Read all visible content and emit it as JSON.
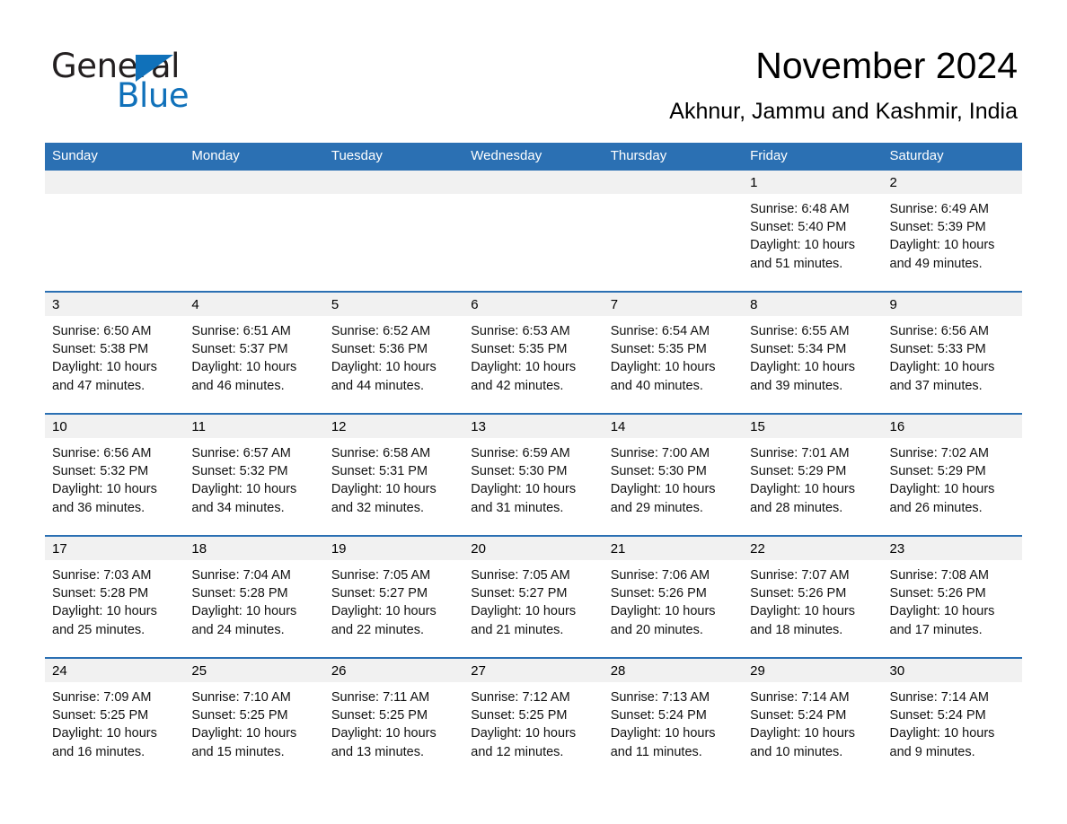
{
  "logo": {
    "word_one": "General",
    "word_two": "Blue",
    "triangle_icon": "triangle-icon",
    "brand_color": "#1071BA"
  },
  "header": {
    "month_title": "November 2024",
    "location": "Akhnur, Jammu and Kashmir, India"
  },
  "theme": {
    "header_blue": "#2B70B3",
    "daynum_band": "#F1F1F1",
    "cell_bg": "#FFFFFF"
  },
  "weekday_headers": [
    "Sunday",
    "Monday",
    "Tuesday",
    "Wednesday",
    "Thursday",
    "Friday",
    "Saturday"
  ],
  "weeks": [
    [
      {
        "day": "",
        "blank": true,
        "sunrise": "",
        "sunset": "",
        "daylight_line1": "",
        "daylight_line2": ""
      },
      {
        "day": "",
        "blank": true,
        "sunrise": "",
        "sunset": "",
        "daylight_line1": "",
        "daylight_line2": ""
      },
      {
        "day": "",
        "blank": true,
        "sunrise": "",
        "sunset": "",
        "daylight_line1": "",
        "daylight_line2": ""
      },
      {
        "day": "",
        "blank": true,
        "sunrise": "",
        "sunset": "",
        "daylight_line1": "",
        "daylight_line2": ""
      },
      {
        "day": "",
        "blank": true,
        "sunrise": "",
        "sunset": "",
        "daylight_line1": "",
        "daylight_line2": ""
      },
      {
        "day": "1",
        "blank": false,
        "sunrise": "Sunrise: 6:48 AM",
        "sunset": "Sunset: 5:40 PM",
        "daylight_line1": "Daylight: 10 hours",
        "daylight_line2": "and 51 minutes."
      },
      {
        "day": "2",
        "blank": false,
        "sunrise": "Sunrise: 6:49 AM",
        "sunset": "Sunset: 5:39 PM",
        "daylight_line1": "Daylight: 10 hours",
        "daylight_line2": "and 49 minutes."
      }
    ],
    [
      {
        "day": "3",
        "blank": false,
        "sunrise": "Sunrise: 6:50 AM",
        "sunset": "Sunset: 5:38 PM",
        "daylight_line1": "Daylight: 10 hours",
        "daylight_line2": "and 47 minutes."
      },
      {
        "day": "4",
        "blank": false,
        "sunrise": "Sunrise: 6:51 AM",
        "sunset": "Sunset: 5:37 PM",
        "daylight_line1": "Daylight: 10 hours",
        "daylight_line2": "and 46 minutes."
      },
      {
        "day": "5",
        "blank": false,
        "sunrise": "Sunrise: 6:52 AM",
        "sunset": "Sunset: 5:36 PM",
        "daylight_line1": "Daylight: 10 hours",
        "daylight_line2": "and 44 minutes."
      },
      {
        "day": "6",
        "blank": false,
        "sunrise": "Sunrise: 6:53 AM",
        "sunset": "Sunset: 5:35 PM",
        "daylight_line1": "Daylight: 10 hours",
        "daylight_line2": "and 42 minutes."
      },
      {
        "day": "7",
        "blank": false,
        "sunrise": "Sunrise: 6:54 AM",
        "sunset": "Sunset: 5:35 PM",
        "daylight_line1": "Daylight: 10 hours",
        "daylight_line2": "and 40 minutes."
      },
      {
        "day": "8",
        "blank": false,
        "sunrise": "Sunrise: 6:55 AM",
        "sunset": "Sunset: 5:34 PM",
        "daylight_line1": "Daylight: 10 hours",
        "daylight_line2": "and 39 minutes."
      },
      {
        "day": "9",
        "blank": false,
        "sunrise": "Sunrise: 6:56 AM",
        "sunset": "Sunset: 5:33 PM",
        "daylight_line1": "Daylight: 10 hours",
        "daylight_line2": "and 37 minutes."
      }
    ],
    [
      {
        "day": "10",
        "blank": false,
        "sunrise": "Sunrise: 6:56 AM",
        "sunset": "Sunset: 5:32 PM",
        "daylight_line1": "Daylight: 10 hours",
        "daylight_line2": "and 36 minutes."
      },
      {
        "day": "11",
        "blank": false,
        "sunrise": "Sunrise: 6:57 AM",
        "sunset": "Sunset: 5:32 PM",
        "daylight_line1": "Daylight: 10 hours",
        "daylight_line2": "and 34 minutes."
      },
      {
        "day": "12",
        "blank": false,
        "sunrise": "Sunrise: 6:58 AM",
        "sunset": "Sunset: 5:31 PM",
        "daylight_line1": "Daylight: 10 hours",
        "daylight_line2": "and 32 minutes."
      },
      {
        "day": "13",
        "blank": false,
        "sunrise": "Sunrise: 6:59 AM",
        "sunset": "Sunset: 5:30 PM",
        "daylight_line1": "Daylight: 10 hours",
        "daylight_line2": "and 31 minutes."
      },
      {
        "day": "14",
        "blank": false,
        "sunrise": "Sunrise: 7:00 AM",
        "sunset": "Sunset: 5:30 PM",
        "daylight_line1": "Daylight: 10 hours",
        "daylight_line2": "and 29 minutes."
      },
      {
        "day": "15",
        "blank": false,
        "sunrise": "Sunrise: 7:01 AM",
        "sunset": "Sunset: 5:29 PM",
        "daylight_line1": "Daylight: 10 hours",
        "daylight_line2": "and 28 minutes."
      },
      {
        "day": "16",
        "blank": false,
        "sunrise": "Sunrise: 7:02 AM",
        "sunset": "Sunset: 5:29 PM",
        "daylight_line1": "Daylight: 10 hours",
        "daylight_line2": "and 26 minutes."
      }
    ],
    [
      {
        "day": "17",
        "blank": false,
        "sunrise": "Sunrise: 7:03 AM",
        "sunset": "Sunset: 5:28 PM",
        "daylight_line1": "Daylight: 10 hours",
        "daylight_line2": "and 25 minutes."
      },
      {
        "day": "18",
        "blank": false,
        "sunrise": "Sunrise: 7:04 AM",
        "sunset": "Sunset: 5:28 PM",
        "daylight_line1": "Daylight: 10 hours",
        "daylight_line2": "and 24 minutes."
      },
      {
        "day": "19",
        "blank": false,
        "sunrise": "Sunrise: 7:05 AM",
        "sunset": "Sunset: 5:27 PM",
        "daylight_line1": "Daylight: 10 hours",
        "daylight_line2": "and 22 minutes."
      },
      {
        "day": "20",
        "blank": false,
        "sunrise": "Sunrise: 7:05 AM",
        "sunset": "Sunset: 5:27 PM",
        "daylight_line1": "Daylight: 10 hours",
        "daylight_line2": "and 21 minutes."
      },
      {
        "day": "21",
        "blank": false,
        "sunrise": "Sunrise: 7:06 AM",
        "sunset": "Sunset: 5:26 PM",
        "daylight_line1": "Daylight: 10 hours",
        "daylight_line2": "and 20 minutes."
      },
      {
        "day": "22",
        "blank": false,
        "sunrise": "Sunrise: 7:07 AM",
        "sunset": "Sunset: 5:26 PM",
        "daylight_line1": "Daylight: 10 hours",
        "daylight_line2": "and 18 minutes."
      },
      {
        "day": "23",
        "blank": false,
        "sunrise": "Sunrise: 7:08 AM",
        "sunset": "Sunset: 5:26 PM",
        "daylight_line1": "Daylight: 10 hours",
        "daylight_line2": "and 17 minutes."
      }
    ],
    [
      {
        "day": "24",
        "blank": false,
        "sunrise": "Sunrise: 7:09 AM",
        "sunset": "Sunset: 5:25 PM",
        "daylight_line1": "Daylight: 10 hours",
        "daylight_line2": "and 16 minutes."
      },
      {
        "day": "25",
        "blank": false,
        "sunrise": "Sunrise: 7:10 AM",
        "sunset": "Sunset: 5:25 PM",
        "daylight_line1": "Daylight: 10 hours",
        "daylight_line2": "and 15 minutes."
      },
      {
        "day": "26",
        "blank": false,
        "sunrise": "Sunrise: 7:11 AM",
        "sunset": "Sunset: 5:25 PM",
        "daylight_line1": "Daylight: 10 hours",
        "daylight_line2": "and 13 minutes."
      },
      {
        "day": "27",
        "blank": false,
        "sunrise": "Sunrise: 7:12 AM",
        "sunset": "Sunset: 5:25 PM",
        "daylight_line1": "Daylight: 10 hours",
        "daylight_line2": "and 12 minutes."
      },
      {
        "day": "28",
        "blank": false,
        "sunrise": "Sunrise: 7:13 AM",
        "sunset": "Sunset: 5:24 PM",
        "daylight_line1": "Daylight: 10 hours",
        "daylight_line2": "and 11 minutes."
      },
      {
        "day": "29",
        "blank": false,
        "sunrise": "Sunrise: 7:14 AM",
        "sunset": "Sunset: 5:24 PM",
        "daylight_line1": "Daylight: 10 hours",
        "daylight_line2": "and 10 minutes."
      },
      {
        "day": "30",
        "blank": false,
        "sunrise": "Sunrise: 7:14 AM",
        "sunset": "Sunset: 5:24 PM",
        "daylight_line1": "Daylight: 10 hours",
        "daylight_line2": "and 9 minutes."
      }
    ]
  ]
}
